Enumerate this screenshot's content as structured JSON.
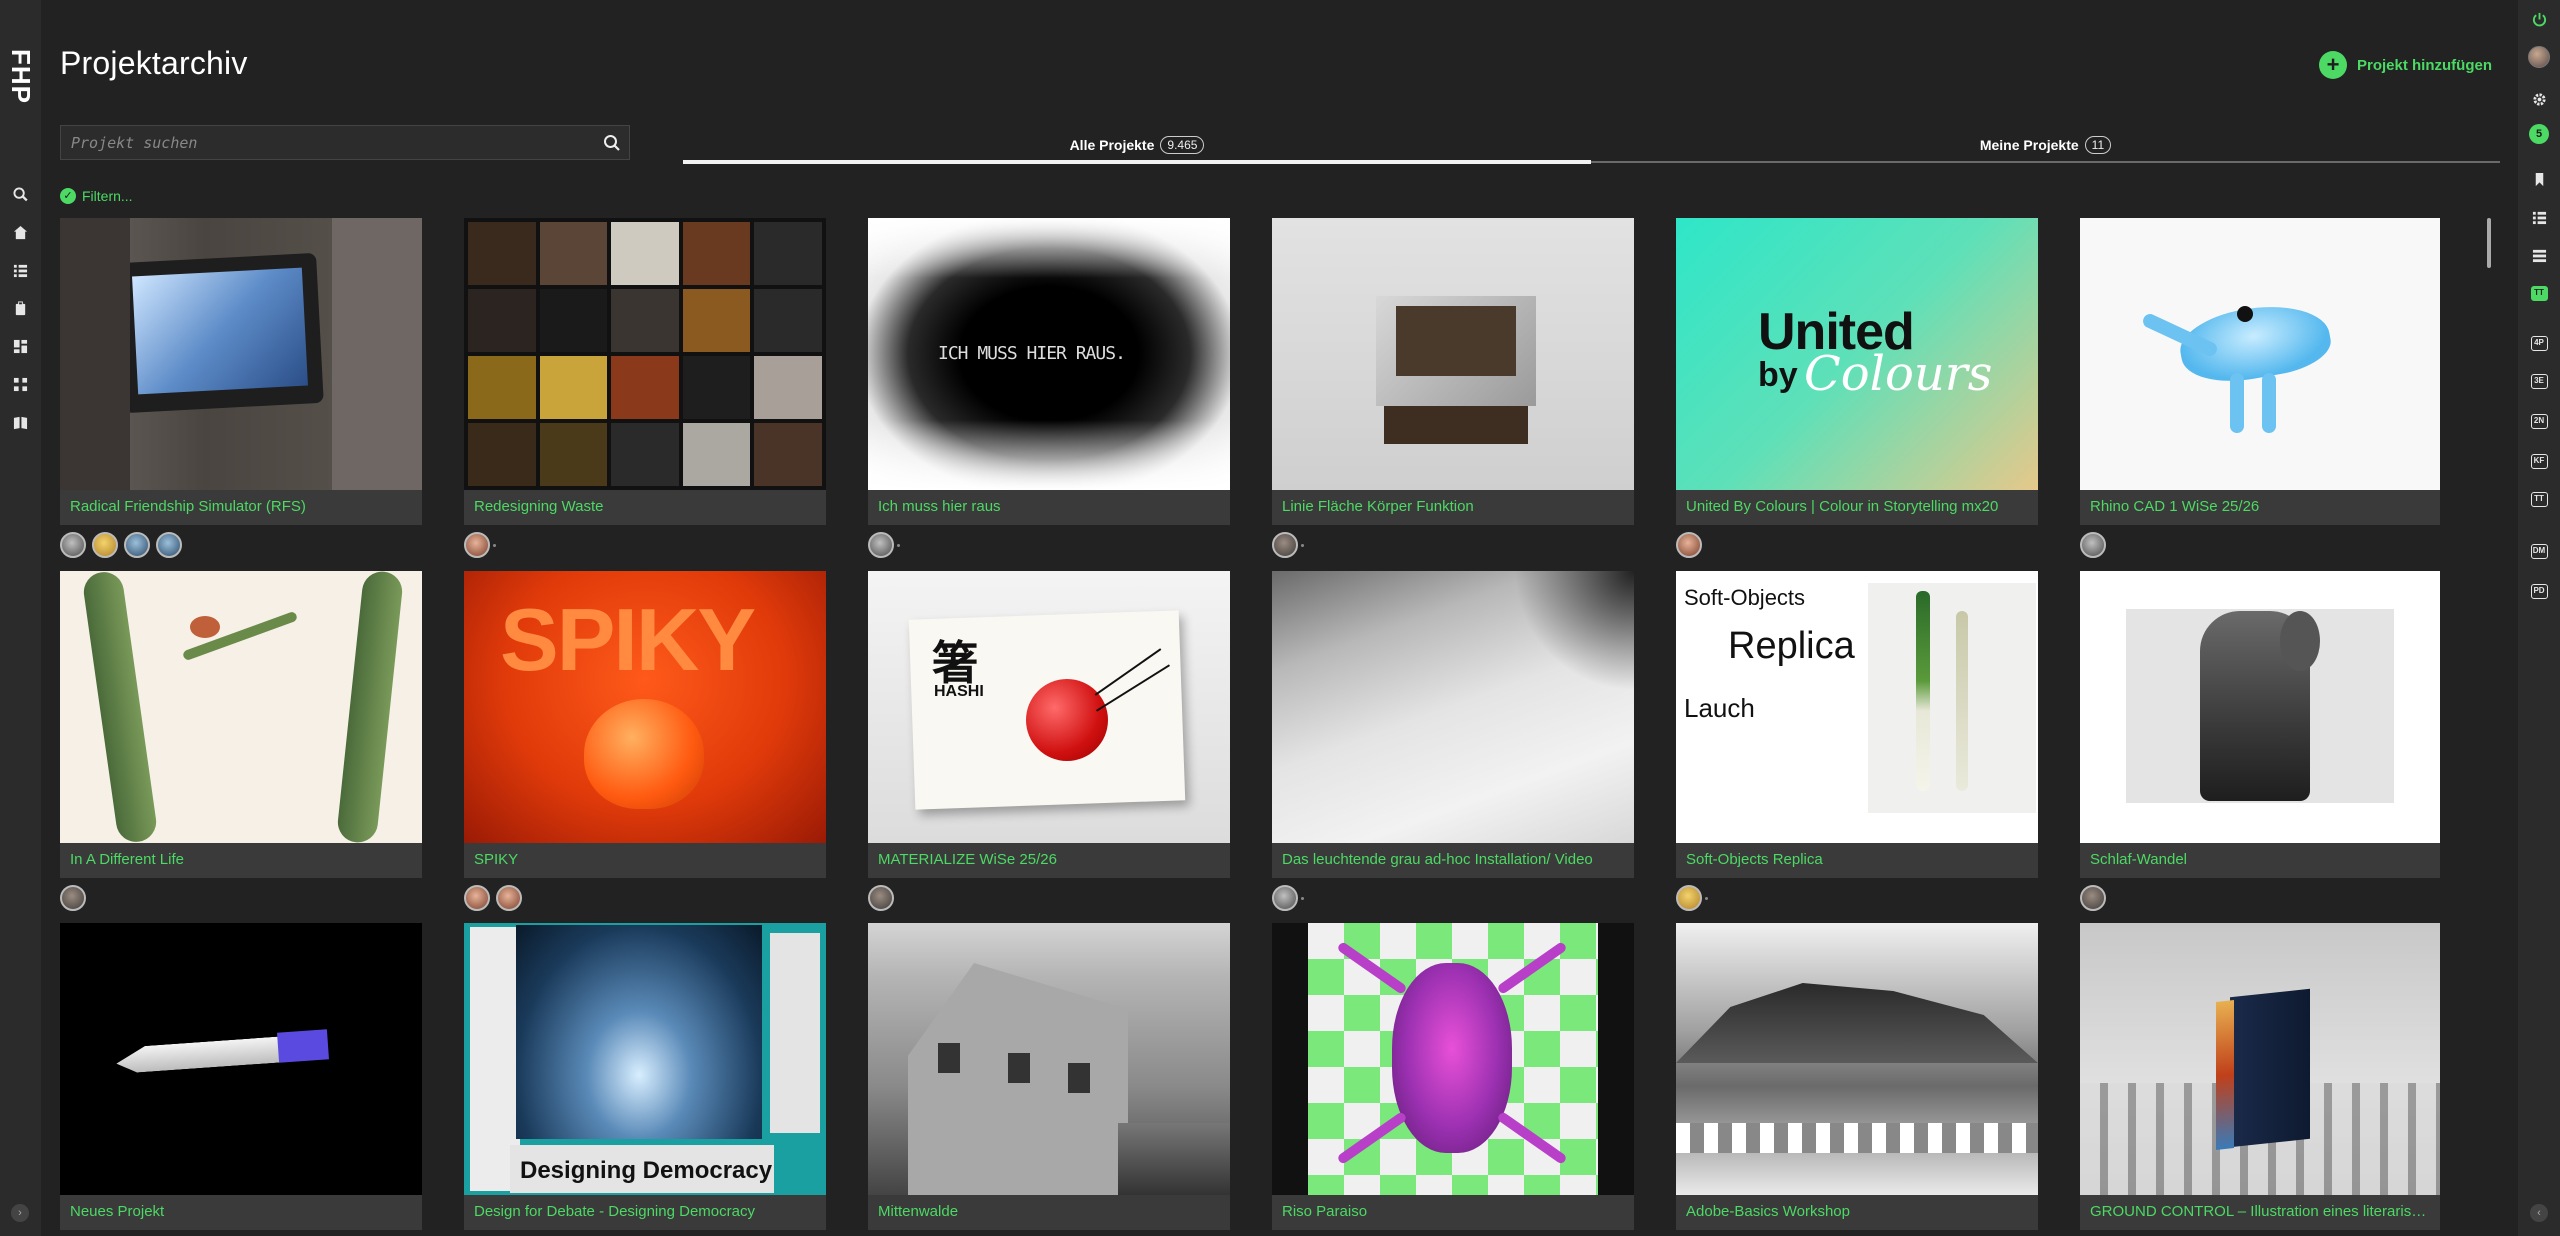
{
  "app": {
    "logo_text": "FHP",
    "page_title": "Projektarchiv",
    "add_project_label": "Projekt hinzufügen"
  },
  "search": {
    "placeholder": "Projekt suchen"
  },
  "tabs": [
    {
      "label": "Alle Projekte",
      "count": "9.465",
      "active": true
    },
    {
      "label": "Meine Projekte",
      "count": "11",
      "active": false
    }
  ],
  "filter_label": "Filtern...",
  "right_bar": {
    "notification_count": "5",
    "badges": [
      "TT",
      "4P",
      "3E",
      "2N",
      "KF",
      "TT",
      "DM",
      "PD"
    ]
  },
  "projects": [
    {
      "title": "Radical Friendship Simulator (RFS)",
      "members": [
        "d",
        "e",
        "c",
        "c"
      ]
    },
    {
      "title": "Redesigning Waste",
      "members": [
        "f"
      ]
    },
    {
      "title": "Ich muss hier raus",
      "members": [
        "d"
      ],
      "image_text": "ICH MUSS HIER RAUS."
    },
    {
      "title": "Linie Fläche Körper Funktion",
      "members": [
        "a"
      ]
    },
    {
      "title": "United By Colours | Colour in Storytelling mx20",
      "members": [
        "f"
      ],
      "image_text_1": "United",
      "image_text_2": "by",
      "image_text_3": "Colours"
    },
    {
      "title": "Rhino CAD 1 WiSe 25/26",
      "members": [
        "d"
      ]
    },
    {
      "title": "In A Different Life",
      "members": [
        "a"
      ]
    },
    {
      "title": "SPIKY",
      "members": [
        "f",
        "f"
      ],
      "image_text": "SPIKY"
    },
    {
      "title": "MATERIALIZE WiSe 25/26",
      "members": [
        "d"
      ],
      "image_text_1": "箸",
      "image_text_2": "HASHI"
    },
    {
      "title": "Das leuchtende grau ad-hoc Installation/ Video",
      "members": [
        "d"
      ]
    },
    {
      "title": "Soft-Objects Replica",
      "members": [
        "e"
      ],
      "image_text_1": "Soft-Objects",
      "image_text_2": "Replica",
      "image_text_3": "Lauch"
    },
    {
      "title": "Schlaf-Wandel",
      "members": [
        "a"
      ]
    },
    {
      "title": "Neues Projekt",
      "members": []
    },
    {
      "title": "Design for Debate - Designing Democracy",
      "members": [],
      "image_text": "Designing Democracy"
    },
    {
      "title": "Mittenwalde",
      "members": []
    },
    {
      "title": "Riso Paraiso",
      "members": []
    },
    {
      "title": "Adobe-Basics Workshop",
      "members": []
    },
    {
      "title": "GROUND CONTROL – Illustration eines literarischen Werkes",
      "members": []
    }
  ]
}
